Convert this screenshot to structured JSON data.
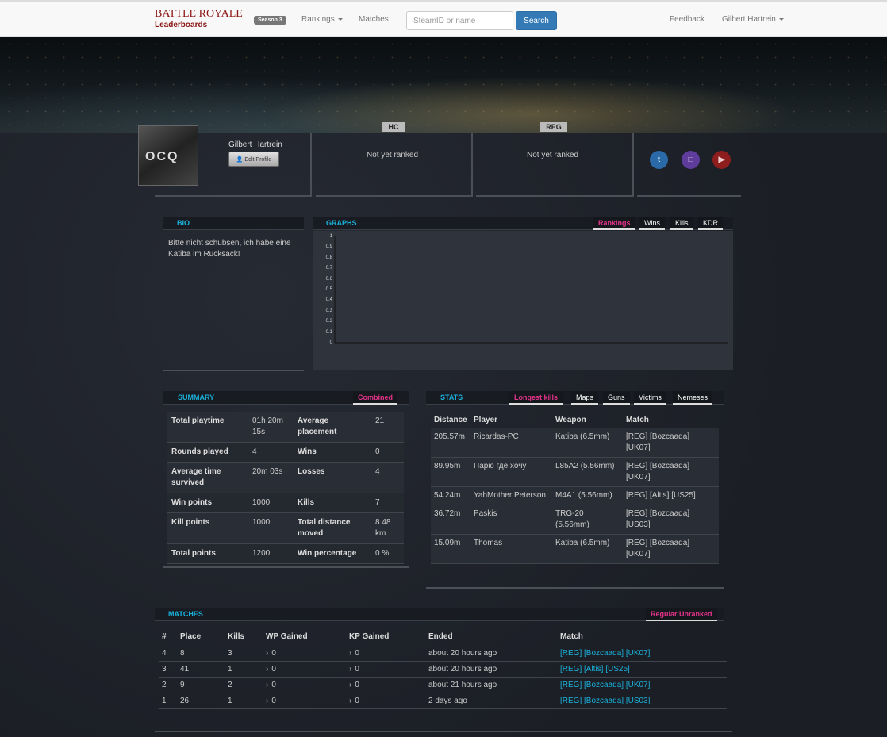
{
  "navbar": {
    "brand_title": "BATTLE ROYALE",
    "brand_sub": "Leaderboards",
    "season_badge": "Season 3",
    "rankings": "Rankings",
    "matches": "Matches",
    "search_placeholder": "SteamID or name",
    "search_button": "Search",
    "feedback": "Feedback",
    "user": "Gilbert Hartrein"
  },
  "profile": {
    "name": "Gilbert Hartrein",
    "edit_button": "Edit Profile",
    "avatar_logo": "OCQ",
    "hc_label": "HC",
    "reg_label": "REG",
    "hc_status": "Not yet ranked",
    "reg_status": "Not yet ranked",
    "social": [
      "twitter-icon",
      "twitch-icon",
      "youtube-icon"
    ]
  },
  "bio": {
    "title": "BIO",
    "text": "Bitte nicht schubsen, ich habe eine Katiba im Rucksack!"
  },
  "graphs": {
    "title": "GRAPHS",
    "tabs": [
      "Rankings",
      "Wins",
      "Kills",
      "KDR"
    ],
    "active_tab": "Rankings",
    "y_ticks": [
      "1",
      "0.9",
      "0.8",
      "0.7",
      "0.6",
      "0.5",
      "0.4",
      "0.3",
      "0.2",
      "0.1",
      "0"
    ]
  },
  "chart_data": {
    "type": "line",
    "series": [],
    "ylim": [
      0,
      1
    ]
  },
  "summary": {
    "title": "SUMMARY",
    "tab": "Combined",
    "rows": [
      [
        "Total playtime",
        "01h 20m 15s",
        "Average placement",
        "21"
      ],
      [
        "Rounds played",
        "4",
        "Wins",
        "0"
      ],
      [
        "Average time survived",
        "20m 03s",
        "Losses",
        "4"
      ],
      [
        "Win points",
        "1000",
        "Kills",
        "7"
      ],
      [
        "Kill points",
        "1000",
        "Total distance moved",
        "8.48 km"
      ],
      [
        "Total points",
        "1200",
        "Win percentage",
        "0 %"
      ]
    ]
  },
  "stats": {
    "title": "STATS",
    "tabs": [
      "Longest kills",
      "Maps",
      "Guns",
      "Victims",
      "Nemeses"
    ],
    "active_tab": "Longest kills",
    "headers": [
      "Distance",
      "Player",
      "Weapon",
      "Match"
    ],
    "rows": [
      [
        "205.57m",
        "Ricardas-PC",
        "Katiba (6.5mm)",
        "[REG] [Bozcaada] [UK07]"
      ],
      [
        "89.95m",
        "Парю где хочу",
        "L85A2 (5.56mm)",
        "[REG] [Bozcaada] [UK07]"
      ],
      [
        "54.24m",
        "YahMother Peterson",
        "M4A1 (5.56mm)",
        "[REG] [Altis] [US25]"
      ],
      [
        "36.72m",
        "Paskis",
        "TRG-20 (5.56mm)",
        "[REG] [Bozcaada] [US03]"
      ],
      [
        "15.09m",
        "Thomas",
        "Katiba (6.5mm)",
        "[REG] [Bozcaada] [UK07]"
      ]
    ]
  },
  "matches": {
    "title": "MATCHES",
    "tab": "Regular Unranked",
    "headers": [
      "#",
      "Place",
      "Kills",
      "WP Gained",
      "KP Gained",
      "Ended",
      "Match"
    ],
    "rows": [
      [
        "4",
        "8",
        "3",
        "0",
        "0",
        "about 20 hours ago",
        "[REG] [Bozcaada] [UK07]"
      ],
      [
        "3",
        "41",
        "1",
        "0",
        "0",
        "about 20 hours ago",
        "[REG] [Altis] [US25]"
      ],
      [
        "2",
        "9",
        "2",
        "0",
        "0",
        "about 21 hours ago",
        "[REG] [Bozcaada] [UK07]"
      ],
      [
        "1",
        "26",
        "1",
        "0",
        "0",
        "2 days ago",
        "[REG] [Bozcaada] [US03]"
      ]
    ]
  },
  "colors": {
    "accent_cyan": "#1ab2dc",
    "accent_pink": "#e5338a",
    "brand_red": "#8b1414",
    "player_gold": "#c8b068"
  }
}
